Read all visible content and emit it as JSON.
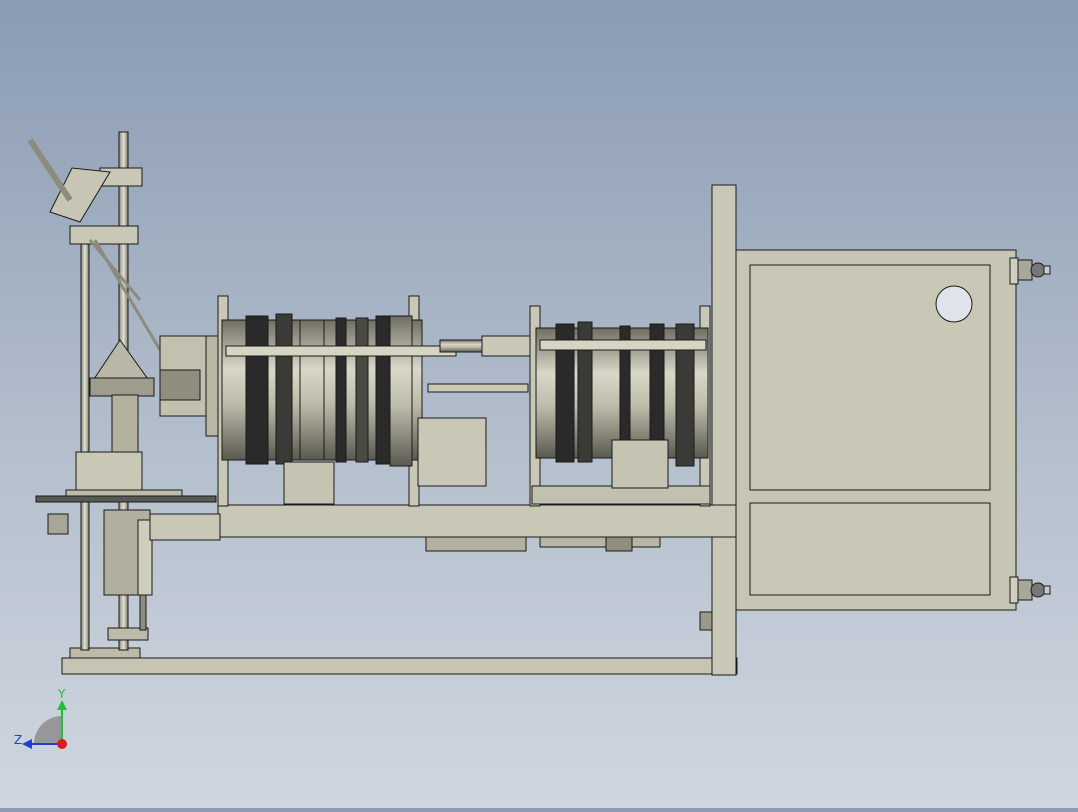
{
  "triad": {
    "y_label": "Y",
    "z_label": "Z",
    "y_color": "#1fbf3a",
    "z_color": "#1e3fd6",
    "x_color": "#e01a1a"
  },
  "colors": {
    "metal": "#c9c8b6",
    "metal_dark": "#8f8e7e",
    "outline": "#1a1a1a",
    "drum_dark": "#2a2a2a"
  }
}
